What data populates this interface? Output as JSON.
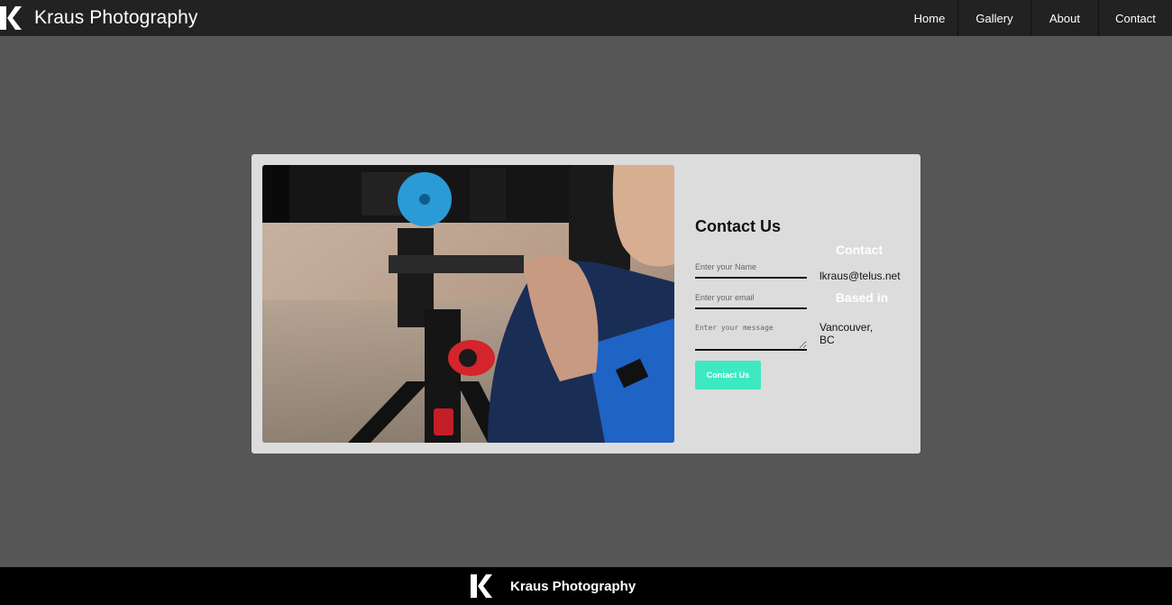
{
  "header": {
    "brand": "Kraus Photography",
    "nav": [
      {
        "label": "Home"
      },
      {
        "label": "Gallery"
      },
      {
        "label": "About"
      },
      {
        "label": "Contact"
      }
    ]
  },
  "contact_form": {
    "title": "Contact Us",
    "name_placeholder": "Enter your Name",
    "email_placeholder": "Enter your email",
    "message_placeholder": "Enter your message",
    "submit_label": "Contact Us"
  },
  "info": {
    "contact_heading": "Contact",
    "email": "lkraus@telus.net",
    "based_heading": "Based in",
    "city_line1": "Vancouver,",
    "city_line2": "BC"
  },
  "footer": {
    "brand": "Kraus Photography"
  },
  "colors": {
    "page_bg": "#565656",
    "header_bg": "#222222",
    "card_bg": "#dcdcdc",
    "accent": "#3ee8c1",
    "footer_bg": "#000000"
  },
  "icons": {
    "logo": "k-logo-icon"
  },
  "image": {
    "subject": "photographer-with-telephoto-camera-on-tripod"
  }
}
